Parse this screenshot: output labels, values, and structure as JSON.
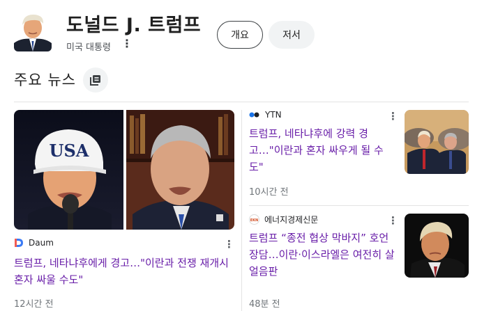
{
  "header": {
    "title": "도널드 J. 트럼프",
    "subtitle": "미국 대통령",
    "more_icon": "vertical-dots-icon",
    "tabs": [
      {
        "label": "개요",
        "selected": true
      },
      {
        "label": "저서",
        "selected": false
      }
    ]
  },
  "section": {
    "title": "주요 뉴스",
    "icon": "stacked-pages-icon"
  },
  "articles": [
    {
      "source": "Daum",
      "source_icon": "daum-logo-icon",
      "headline": "트럼프, 네타냐후에게 경고…\"이란과 전쟁 재개시 혼자 싸울 수도\"",
      "time": "12시간 전",
      "image_text": "USA"
    },
    {
      "source": "YTN",
      "source_icon": "ytn-logo-icon",
      "headline": "트럼프, 네타냐후에 강력 경고…\"이란과 혼자 싸우게 될 수도\"",
      "time": "10시간 전"
    },
    {
      "source": "에너지경제신문",
      "source_icon": "ekn-logo-icon",
      "source_logo_text": "EKN",
      "headline": "트럼프 “종전 협상 막바지” 호언장담…이란·이스라엘은 여전히 살얼음판",
      "time": "48분 전"
    }
  ],
  "colors": {
    "visited_link": "#681da8",
    "meta_text": "#70757a",
    "chip_bg": "#f1f3f4"
  }
}
